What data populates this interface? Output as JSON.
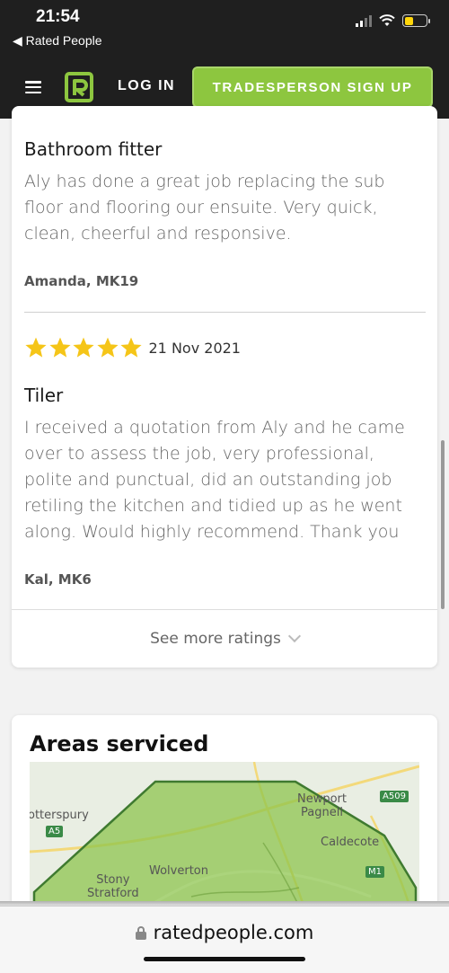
{
  "status_bar": {
    "time": "21:54",
    "back_label": "◀ Rated People"
  },
  "nav": {
    "login_label": "LOG IN",
    "signup_label": "TRADESPERSON SIGN UP",
    "brand_color": "#8dc63f"
  },
  "reviews": [
    {
      "title": "Bathroom fitter",
      "text": "Aly has done a great job replacing the sub floor and flooring our ensuite. Very quick, clean, cheerful and responsive.",
      "author": "Amanda, MK19"
    },
    {
      "rating": 5,
      "date": "21 Nov 2021",
      "title": "Tiler",
      "text": "I received a quotation from Aly and he came over to assess the job, very professional, polite and punctual, did an outstanding job retiling the kitchen and tidied up as he went along. Would highly recommend. Thank you",
      "author": "Kal, MK6"
    }
  ],
  "see_more_label": "See more ratings",
  "areas": {
    "title": "Areas serviced",
    "map_labels": {
      "potterspury": "otterspury",
      "newport_pagnell": "Newport\nPagnell",
      "caldecote": "Caldecote",
      "wolverton": "Wolverton",
      "stony_stratford": "Stony\nStratford"
    },
    "road_badges": {
      "a509": "A509",
      "a5": "A5",
      "m1": "M1"
    }
  },
  "browser": {
    "url": "ratedpeople.com"
  }
}
